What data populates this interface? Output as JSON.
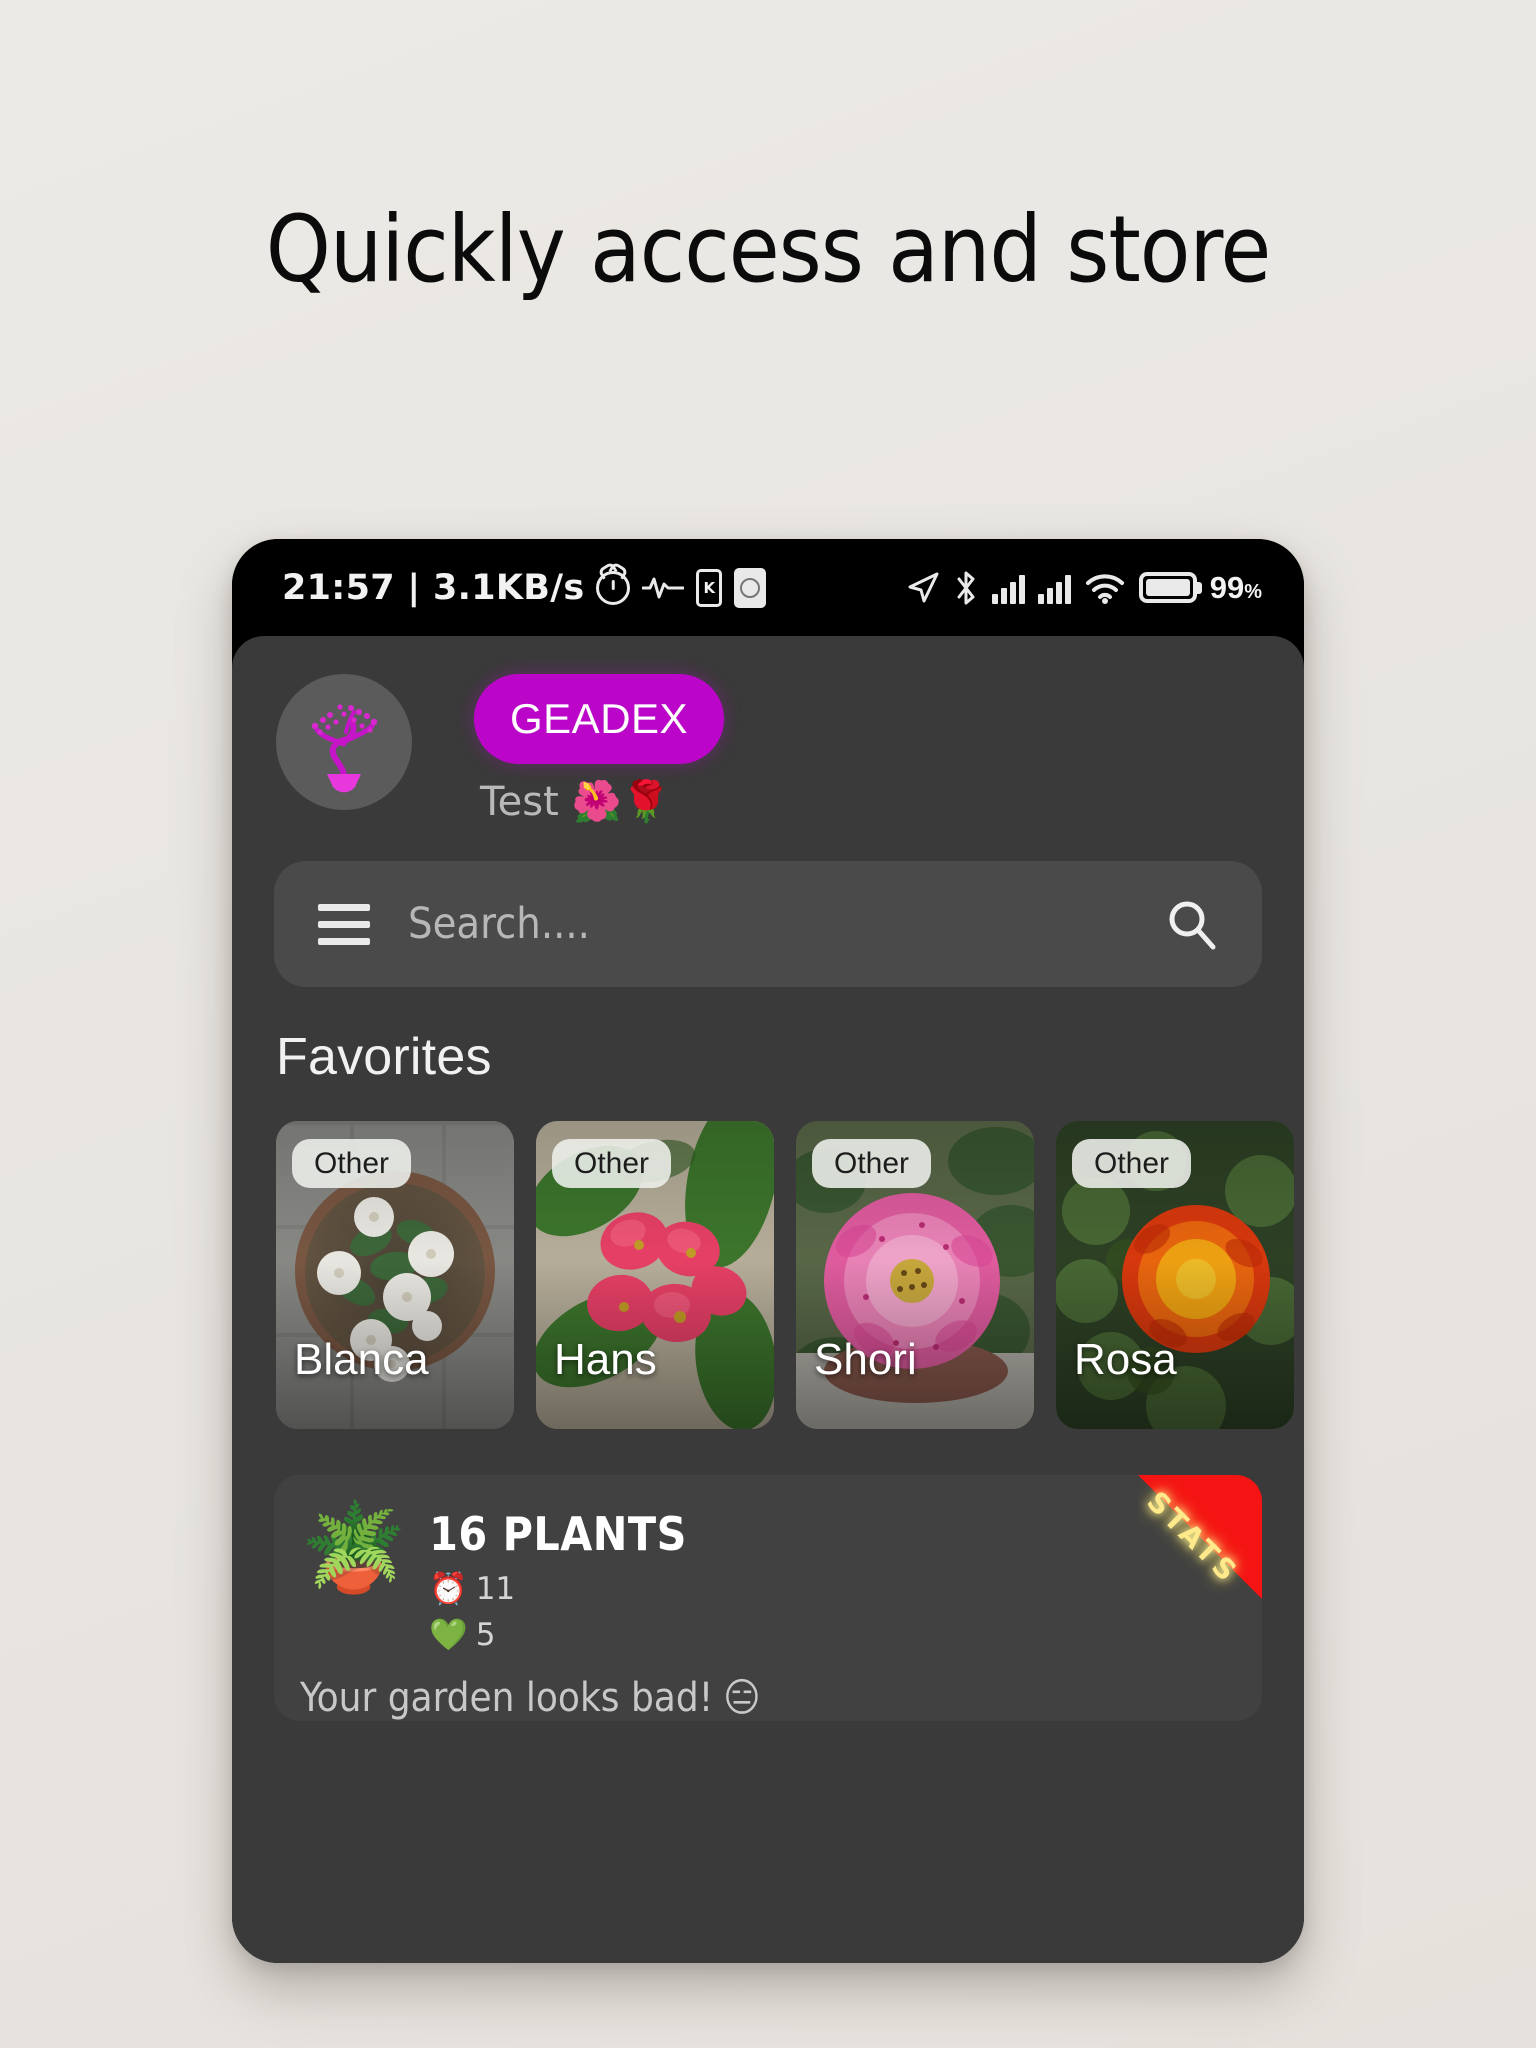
{
  "headline": "Quickly access and store",
  "statusbar": {
    "clock": "21:57 | 3.1KB/s",
    "battery_percent": "99",
    "percent_symbol": "%",
    "icons": [
      "alarm-clock-icon",
      "heartbeat-icon",
      "device-icon",
      "nfc-card-icon",
      "location-arrow-icon",
      "bluetooth-icon",
      "signal-bars-sim1-icon",
      "signal-bars-sim2-icon",
      "wifi-icon",
      "battery-icon"
    ]
  },
  "app": {
    "brand_button": "GEADEX",
    "brand_color": "#bb06c9",
    "user_name": "Test 🌺🌹",
    "avatar_icon": "bonsai-plant-logo",
    "search": {
      "placeholder": "Search....",
      "value": "",
      "menu_icon": "hamburger-menu-icon",
      "search_icon": "search-icon"
    },
    "favorites": {
      "title": "Favorites",
      "cards": [
        {
          "name": "Blanca",
          "chip": "Other",
          "photo": "white-flowers-in-pot"
        },
        {
          "name": "Hans",
          "chip": "Other",
          "photo": "pink-crown-of-thorns-flowers"
        },
        {
          "name": "Shori",
          "chip": "Other",
          "photo": "pink-rose-bloom"
        },
        {
          "name": "Rosa",
          "chip": "Other",
          "photo": "orange-rose-bloom"
        }
      ]
    },
    "stats": {
      "plant_icon": "potted-flowers-emoji",
      "count_label": "16 PLANTS",
      "reminder_icon": "⏰",
      "reminder_count": "11",
      "health_icon": "💚",
      "health_count": "5",
      "message": "Your garden looks bad!",
      "message_emoji": "😑",
      "ribbon_label": "STATS",
      "ribbon_color": "#f41414"
    }
  }
}
